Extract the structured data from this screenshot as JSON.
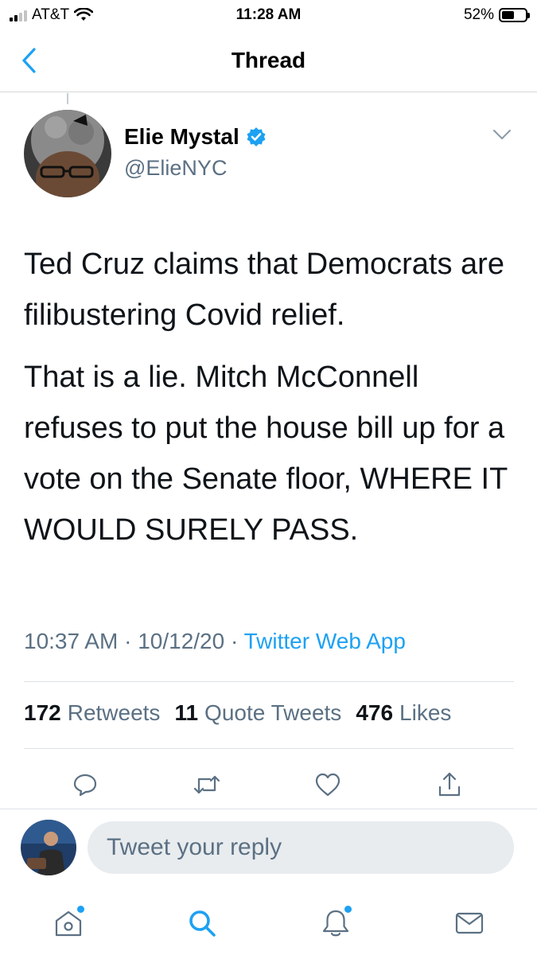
{
  "status_bar": {
    "carrier": "AT&T",
    "time": "11:28 AM",
    "battery": "52%",
    "battery_level": 0.52,
    "signal_bars": 2
  },
  "nav": {
    "title": "Thread",
    "back_icon": "chevron-left-icon"
  },
  "tweet": {
    "author": {
      "name": "Elie Mystal",
      "handle": "@ElieNYC",
      "verified": true
    },
    "paragraphs": [
      "Ted Cruz claims that Democrats are filibustering Covid relief.",
      "That is a lie. Mitch McConnell refuses to put the house bill up for a vote on the Senate floor, WHERE IT WOULD SURELY PASS."
    ],
    "time": "10:37 AM",
    "separator": "·",
    "date": "10/12/20",
    "source": "Twitter Web App",
    "stats": {
      "retweets_count": "172",
      "retweets_label": "Retweets",
      "quotes_count": "11",
      "quotes_label": "Quote Tweets",
      "likes_count": "476",
      "likes_label": "Likes"
    }
  },
  "actions": [
    "reply-icon",
    "retweet-icon",
    "like-icon",
    "share-icon"
  ],
  "reply": {
    "placeholder": "Tweet your reply"
  },
  "tabbar": [
    "home-icon",
    "search-icon",
    "notifications-icon",
    "messages-icon"
  ],
  "colors": {
    "accent": "#1da1f2",
    "secondary_text": "#5b7083",
    "verified": "#1da1f2"
  }
}
